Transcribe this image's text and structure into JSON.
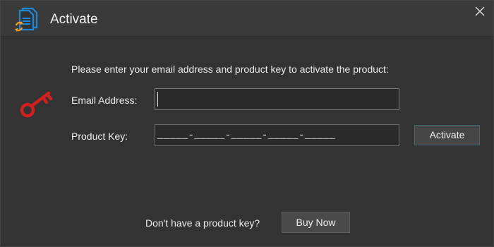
{
  "window": {
    "title": "Activate",
    "close_icon": "close-icon",
    "app_icon": "document-sync-icon"
  },
  "form": {
    "instruction": "Please enter your email address and product key to activate the product:",
    "email_label": "Email Address:",
    "email_value": "",
    "product_key_label": "Product Key:",
    "product_key_mask": "_____-_____-_____-_____-_____",
    "activate_button": "Activate",
    "key_icon": "key-icon",
    "key_icon_color": "#d02020"
  },
  "footer": {
    "prompt": "Don't have a product key?",
    "buy_button": "Buy Now"
  },
  "colors": {
    "background": "#333334",
    "titlebar": "#3a3a3b",
    "accent_blue": "#1e88d8",
    "accent_orange": "#f0a020"
  }
}
